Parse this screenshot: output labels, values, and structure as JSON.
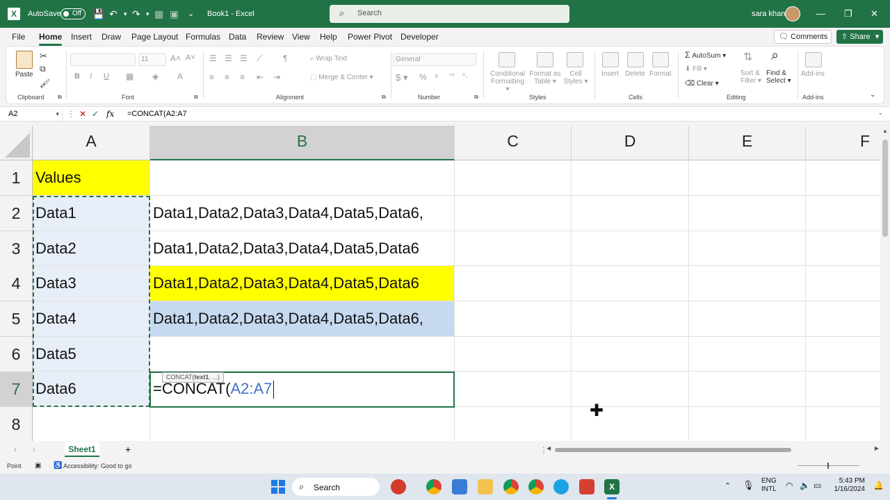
{
  "title_bar": {
    "autosave_label": "AutoSave",
    "autosave_state": "Off",
    "doc_title": "Book1 - Excel",
    "search_placeholder": "Search",
    "username": "sara khan"
  },
  "menu_tabs": [
    "File",
    "Home",
    "Insert",
    "Draw",
    "Page Layout",
    "Formulas",
    "Data",
    "Review",
    "View",
    "Help",
    "Power Pivot",
    "Developer"
  ],
  "active_tab": "Home",
  "buttons": {
    "comments": "Comments",
    "share": "Share"
  },
  "ribbon": {
    "clipboard": {
      "paste": "Paste",
      "label": "Clipboard"
    },
    "font": {
      "label": "Font",
      "font_size": "11"
    },
    "alignment": {
      "wrap_text": "Wrap Text",
      "merge_center": "Merge & Center",
      "label": "Alignment"
    },
    "number": {
      "format": "General",
      "label": "Number"
    },
    "styles": {
      "conditional": "Conditional",
      "formatting": "Formatting",
      "format_as": "Format as",
      "table": "Table",
      "cell": "Cell",
      "cell_styles": "Styles",
      "label": "Styles"
    },
    "cells": {
      "insert": "Insert",
      "delete": "Delete",
      "format": "Format",
      "label": "Cells"
    },
    "editing": {
      "autosum": "AutoSum",
      "fill": "Fill",
      "clear": "Clear",
      "sort": "Sort &",
      "filter": "Filter",
      "find": "Find &",
      "select": "Select",
      "label": "Editing"
    },
    "addins": {
      "addins": "Add-ins",
      "label": "Add-ins"
    }
  },
  "formula_bar": {
    "name_box": "A2",
    "formula": "=CONCAT(A2:A7"
  },
  "columns": [
    "A",
    "B",
    "C",
    "D",
    "E",
    "F"
  ],
  "rows": [
    "1",
    "2",
    "3",
    "4",
    "5",
    "6",
    "7",
    "8"
  ],
  "cells": {
    "A1": "Values",
    "A2": "Data1",
    "A3": "Data2",
    "A4": "Data3",
    "A5": "Data4",
    "A6": "Data5",
    "A7": "Data6",
    "B2": "Data1,Data2,Data3,Data4,Data5,Data6,",
    "B3": "Data1,Data2,Data3,Data4,Data5,Data6",
    "B4": "Data1,Data2,Data3,Data4,Data5,Data6",
    "B5": "Data1,Data2,Data3,Data4,Data5,Data6,",
    "B7_prefix": "=CONCAT(",
    "B7_ref": "A2:A7"
  },
  "tooltip": {
    "fn": "CONCAT(",
    "arg": "text1",
    "rest": ", ...)"
  },
  "sheet_tab": "Sheet1",
  "status": {
    "mode": "Point",
    "accessibility": "Accessibility: Good to go"
  },
  "taskbar": {
    "search": "Search",
    "lang1": "ENG",
    "lang2": "INTL",
    "time": "5:43 PM",
    "date": "1/16/2024"
  },
  "colors": {
    "excel_green": "#217346",
    "yellow": "#ffff00",
    "light_blue": "#c6d9f1",
    "selection_tint": "#e8eef8",
    "ref_blue": "#4472c4"
  }
}
